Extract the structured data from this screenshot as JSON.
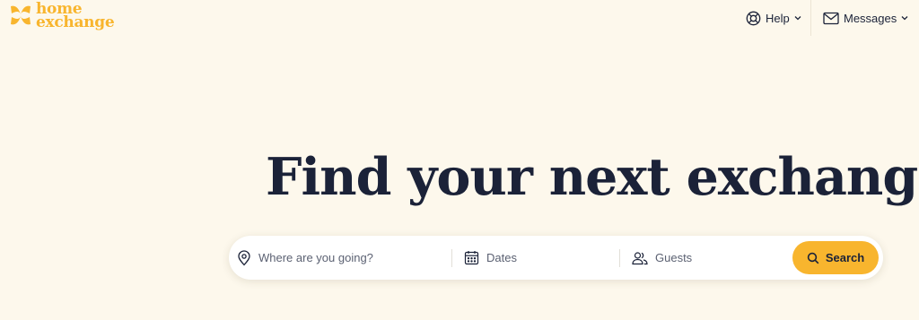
{
  "brand": {
    "line1": "home",
    "line2": "exchange",
    "color": "#f8b52e",
    "icon": "homeexchange-logo-icon"
  },
  "nav": {
    "help": {
      "label": "Help",
      "icon": "lifebuoy-icon"
    },
    "messages": {
      "label": "Messages",
      "icon": "envelope-icon"
    }
  },
  "hero": {
    "title": "Find your next exchange"
  },
  "search": {
    "where": {
      "placeholder": "Where are you going?",
      "icon": "location-pin-icon"
    },
    "dates": {
      "label": "Dates",
      "icon": "calendar-icon"
    },
    "guests": {
      "label": "Guests",
      "icon": "users-icon"
    },
    "button": {
      "label": "Search",
      "icon": "search-icon",
      "color": "#f8b52e"
    }
  },
  "colors": {
    "background": "#fdf8ec",
    "text": "#1b2238",
    "accent": "#f8b52e"
  }
}
